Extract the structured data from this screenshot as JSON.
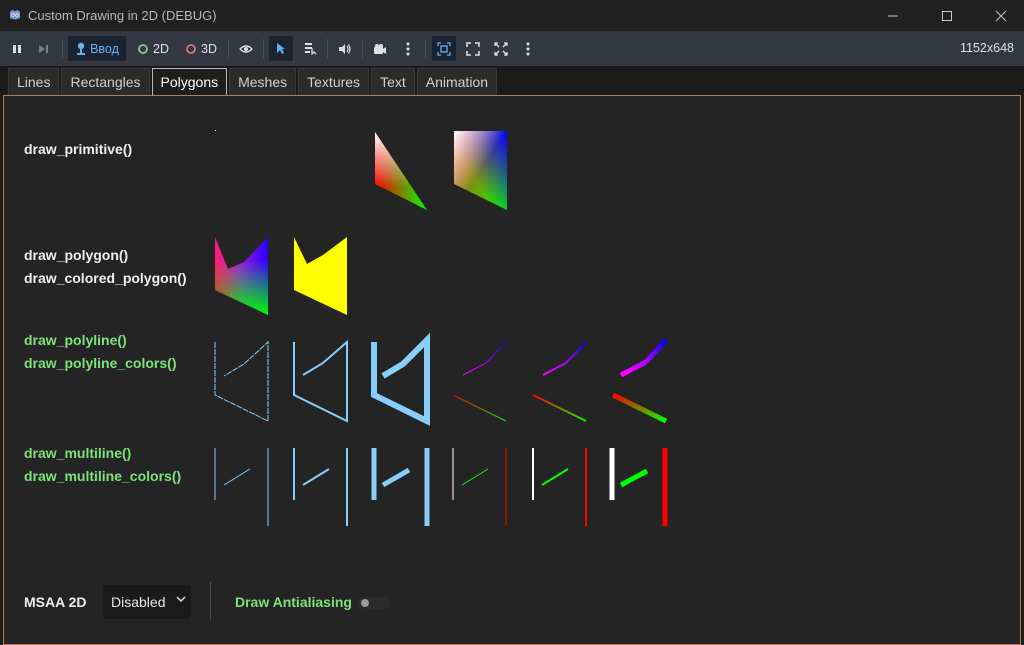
{
  "window": {
    "title": "Custom Drawing in 2D (DEBUG)"
  },
  "toolbar": {
    "input_label": "Ввод",
    "mode_2d_label": "2D",
    "mode_3d_label": "3D",
    "resolution": "1152x648",
    "accent_color": "#5fb3f6"
  },
  "tabs": [
    "Lines",
    "Rectangles",
    "Polygons",
    "Meshes",
    "Textures",
    "Text",
    "Animation"
  ],
  "active_tab": "Polygons",
  "sections": {
    "primitive": {
      "label1": "draw_primitive()"
    },
    "polygon": {
      "label1": "draw_polygon()",
      "label2": "draw_colored_polygon()"
    },
    "polyline": {
      "label1": "draw_polyline()",
      "label2": "draw_polyline_colors()"
    },
    "multiline": {
      "label1": "draw_multiline()",
      "label2": "draw_multiline_colors()"
    }
  },
  "controls": {
    "msaa_label": "MSAA 2D",
    "msaa_value": "Disabled",
    "antialias_label": "Draw Antialiasing",
    "antialias_on": false
  },
  "colors": {
    "line_blue": "#87cefa",
    "polygon_yellow": "#ffff00",
    "label_green": "#7de27a"
  }
}
